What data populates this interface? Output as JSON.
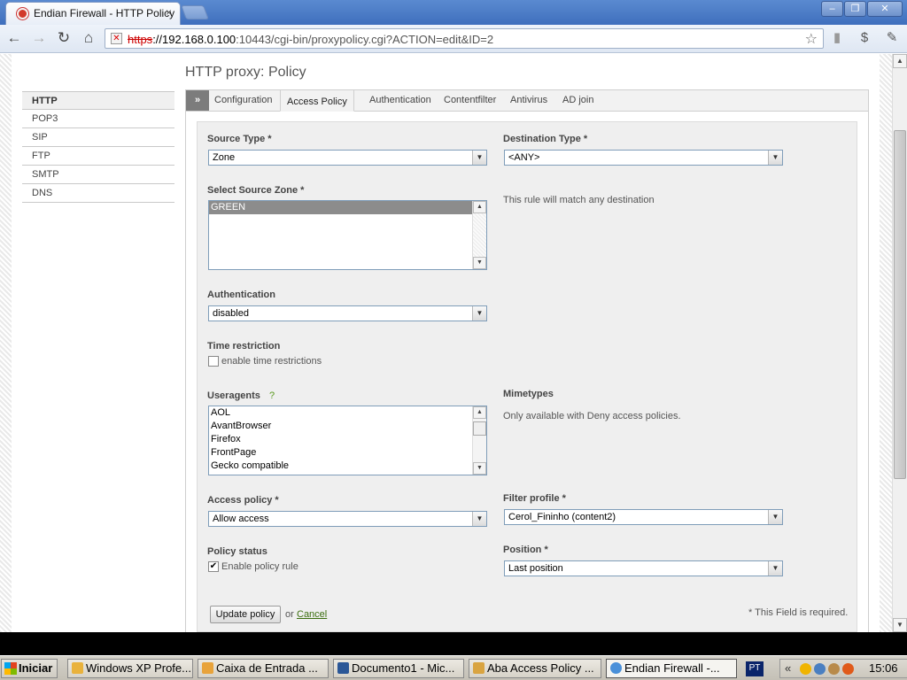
{
  "browser": {
    "tab_title": "Endian Firewall - HTTP Policy",
    "tab_close": "×",
    "url_proto": "https",
    "url_host": "://192.168.0.100",
    "url_rest": ":10443/cgi-bin/proxypolicy.cgi?ACTION=edit&ID=2",
    "window_buttons": [
      "–",
      "❐",
      "✕"
    ]
  },
  "page": {
    "title": "HTTP proxy: Policy"
  },
  "sidebar": {
    "items": [
      {
        "label": "HTTP",
        "active": true
      },
      {
        "label": "POP3",
        "active": false
      },
      {
        "label": "SIP",
        "active": false
      },
      {
        "label": "FTP",
        "active": false
      },
      {
        "label": "SMTP",
        "active": false
      },
      {
        "label": "DNS",
        "active": false
      }
    ]
  },
  "tabs": {
    "arrow": "»",
    "items": [
      "Configuration",
      "Access Policy",
      "Authentication",
      "Contentfilter",
      "Antivirus",
      "AD join"
    ],
    "active": "Access Policy"
  },
  "form": {
    "source_type": {
      "label": "Source Type *",
      "value": "Zone"
    },
    "destination_type": {
      "label": "Destination Type *",
      "value": "<ANY>"
    },
    "source_zone": {
      "label": "Select Source Zone *",
      "options": [
        "GREEN"
      ],
      "selected": "GREEN"
    },
    "destination_note": "This rule will match any destination",
    "authentication": {
      "label": "Authentication",
      "value": "disabled"
    },
    "time_restriction": {
      "label": "Time restriction",
      "checkbox_label": "enable time restrictions",
      "checked": false
    },
    "useragents": {
      "label": "Useragents",
      "help": "?",
      "options": [
        "AOL",
        "AvantBrowser",
        "Firefox",
        "FrontPage",
        "Gecko compatible"
      ]
    },
    "mimetypes": {
      "label": "Mimetypes",
      "note": "Only available with Deny access policies."
    },
    "access_policy": {
      "label": "Access policy *",
      "value": "Allow access"
    },
    "filter_profile": {
      "label": "Filter profile *",
      "value": "Cerol_Fininho (content2)"
    },
    "policy_status": {
      "label": "Policy status",
      "checkbox_label": "Enable policy rule",
      "checked": true,
      "check_glyph": "✔"
    },
    "position": {
      "label": "Position *",
      "value": "Last position"
    },
    "update_button": "Update policy",
    "or_text": "or",
    "cancel_link": "Cancel",
    "required_note": "* This Field is required."
  },
  "taskbar": {
    "start_label": "Iniciar",
    "tasks": [
      {
        "label": "Windows XP Profe...",
        "color": "#e9b23c"
      },
      {
        "label": "Caixa de Entrada ...",
        "color": "#e8a33b"
      },
      {
        "label": "Documento1 - Mic...",
        "color": "#2b5797"
      },
      {
        "label": "Aba Access Policy ...",
        "color": "#d9a441"
      },
      {
        "label": "Endian Firewall -...",
        "color": "#4a90d9",
        "active": true
      }
    ],
    "language": "PT",
    "tray_chevron": "«",
    "clock": "15:06"
  }
}
